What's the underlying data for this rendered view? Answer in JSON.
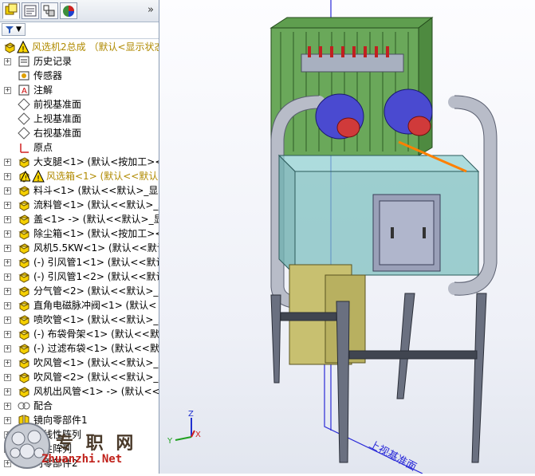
{
  "tabs": [
    {
      "name": "feature-manager-tab",
      "icon": "feature-tree-icon"
    },
    {
      "name": "property-manager-tab",
      "icon": "property-icon"
    },
    {
      "name": "configuration-manager-tab",
      "icon": "configuration-icon"
    },
    {
      "name": "display-manager-tab",
      "icon": "display-pie-icon"
    }
  ],
  "expand_glyph": "»",
  "filter_glyph": "▼",
  "tree": {
    "root": "风选机2总成 （默认<显示状态",
    "items": [
      {
        "label": "历史记录",
        "icon": "history-icon",
        "expand": "+"
      },
      {
        "label": "传感器",
        "icon": "sensor-icon",
        "expand": ""
      },
      {
        "label": "注解",
        "icon": "annotation-icon",
        "expand": "+"
      },
      {
        "label": "前视基准面",
        "icon": "plane-icon",
        "expand": ""
      },
      {
        "label": "上视基准面",
        "icon": "plane-icon",
        "expand": ""
      },
      {
        "label": "右视基准面",
        "icon": "plane-icon",
        "expand": ""
      },
      {
        "label": "原点",
        "icon": "origin-icon",
        "expand": ""
      },
      {
        "label": "大支腿<1> (默认<按加工><",
        "icon": "part-icon",
        "expand": "+"
      },
      {
        "label": "风选箱<1> (默认<<默认",
        "icon": "warning-part-icon",
        "expand": "+",
        "warn": true
      },
      {
        "label": "料斗<1> (默认<<默认>_显示",
        "icon": "part-icon",
        "expand": "+"
      },
      {
        "label": "流料管<1> (默认<<默认>_显",
        "icon": "part-icon",
        "expand": "+"
      },
      {
        "label": "盖<1> -> (默认<<默认>_显",
        "icon": "part-icon",
        "expand": "+"
      },
      {
        "label": "除尘箱<1> (默认<按加工><",
        "icon": "part-icon",
        "expand": "+"
      },
      {
        "label": "风机5.5KW<1> (默认<<默认",
        "icon": "part-icon",
        "expand": "+"
      },
      {
        "label": "(-) 引风管1<1> (默认<<默认",
        "icon": "part-icon",
        "expand": "+"
      },
      {
        "label": "(-) 引风管1<2> (默认<<默认",
        "icon": "part-icon",
        "expand": "+"
      },
      {
        "label": "分气管<2> (默认<<默认>_显",
        "icon": "part-icon",
        "expand": "+"
      },
      {
        "label": "直角电磁脉冲阀<1> (默认<",
        "icon": "part-icon",
        "expand": "+"
      },
      {
        "label": "喷吹管<1> (默认<<默认>_显",
        "icon": "part-icon",
        "expand": "+"
      },
      {
        "label": "(-) 布袋骨架<1> (默认<<默",
        "icon": "part-icon",
        "expand": "+"
      },
      {
        "label": "(-) 过滤布袋<1> (默认<<默",
        "icon": "part-icon",
        "expand": "+"
      },
      {
        "label": "吹风管<1> (默认<<默认>_显",
        "icon": "part-icon",
        "expand": "+"
      },
      {
        "label": "吹风管<2> (默认<<默认>_显",
        "icon": "part-icon",
        "expand": "+"
      },
      {
        "label": "风机出风管<1> -> (默认<<",
        "icon": "part-icon",
        "expand": "+"
      },
      {
        "label": "配合",
        "icon": "mates-icon",
        "expand": "+"
      },
      {
        "label": "镜向零部件1",
        "icon": "mirror-icon",
        "expand": "+"
      },
      {
        "label": "部线性阵列",
        "icon": "pattern-icon",
        "expand": "+"
      },
      {
        "label": "线性阵列",
        "icon": "pattern-icon",
        "expand": "+"
      },
      {
        "label": "向零部件2",
        "icon": "mirror-icon",
        "expand": "+"
      }
    ]
  },
  "viewport": {
    "plane_label": "上视基准面",
    "axis_x": "X",
    "axis_y": "Y",
    "axis_z": "Z"
  },
  "watermark": {
    "text": "专 职 网",
    "url": "Zhuanzhi.Net"
  },
  "colors": {
    "bag_house": "#5f9e4f",
    "blower": "#4a4ad0",
    "box": "#7fc0c0",
    "pipe": "#b8bcc8",
    "hopper": "#c8c070",
    "leg": "#606878",
    "accent_orange": "#ff8000"
  }
}
